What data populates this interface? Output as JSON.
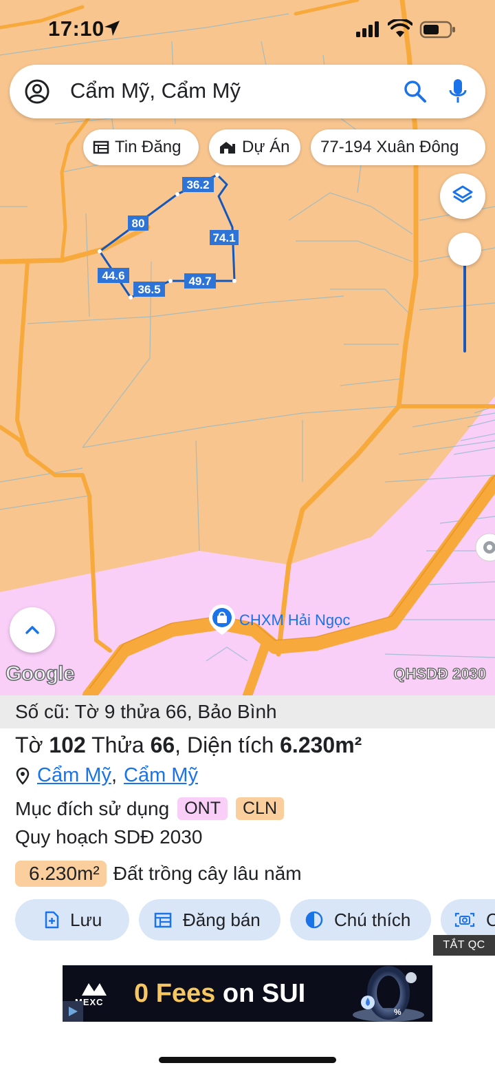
{
  "status_bar": {
    "time": "17:10"
  },
  "search": {
    "query": "Cẩm Mỹ, Cẩm Mỹ"
  },
  "filter_chips": [
    {
      "label": "Tin Đăng",
      "icon": "listing-icon"
    },
    {
      "label": "Dự Án",
      "icon": "project-icon"
    },
    {
      "label": "77-194 Xuân Đông",
      "icon": ""
    }
  ],
  "map": {
    "edge_lengths": [
      "36.2",
      "80",
      "74.1",
      "44.6",
      "36.5",
      "49.7"
    ],
    "poi_label": "CHXM Hải Ngọc",
    "logo": "Google",
    "layer_label": "QHSDĐ 2030",
    "colors": {
      "land_orange": "#f8c58f",
      "land_pink": "#f9cff8",
      "road": "#f7a93b",
      "parcel_outline": "#1565c0"
    }
  },
  "info": {
    "old_parcel": "Số cũ: Tờ 9 thửa 66, Bảo Bình",
    "sheet_label": "Tờ",
    "sheet_number": "102",
    "parcel_label": "Thửa",
    "parcel_number": "66",
    "area_label": "Diện tích",
    "area_value": "6.230m²",
    "location_commune": "Cẩm Mỹ",
    "location_separator": ",",
    "location_district": "Cẩm Mỹ",
    "purpose_label": "Mục đích sử dụng",
    "purpose_badges": [
      {
        "code": "ONT",
        "color": "#f9cff8"
      },
      {
        "code": "CLN",
        "color": "#fbcf9d"
      }
    ],
    "plan_label": "Quy hoạch SDĐ 2030",
    "plan_area": "6.230m²",
    "plan_land_type": "Đất trồng cây lâu năm"
  },
  "actions": [
    {
      "label": "Lưu",
      "icon": "save-doc-icon"
    },
    {
      "label": "Đăng bán",
      "icon": "calendar-icon"
    },
    {
      "label": "Chú thích",
      "icon": "contrast-icon"
    },
    {
      "label": "C",
      "icon": "camera-icon"
    }
  ],
  "ad": {
    "close_label": "TẮT QC",
    "brand": "MEXC",
    "headline_highlight": "0 Fees",
    "headline_rest": " on SUI"
  }
}
